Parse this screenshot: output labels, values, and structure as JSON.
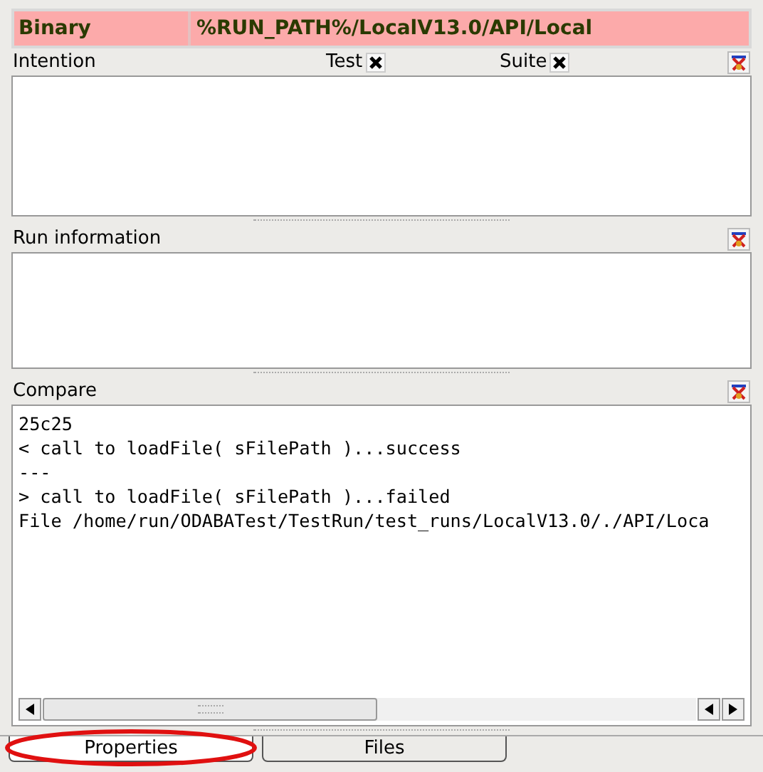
{
  "header": {
    "label": "Binary",
    "value": "%RUN_PATH%/LocalV13.0/API/Local"
  },
  "panels": [
    {
      "kind": "intention",
      "title": "Intention",
      "checks": [
        {
          "label": "Test",
          "checked": true
        },
        {
          "label": "Suite",
          "checked": true
        }
      ]
    },
    {
      "kind": "plain",
      "title": "Run information"
    },
    {
      "kind": "compare",
      "title": "Compare",
      "lines": [
        "25c25",
        "< call to loadFile( sFilePath )...success",
        "---",
        "> call to loadFile( sFilePath )...failed",
        "File /home/run/ODABATest/TestRun/test_runs/LocalV13.0/./API/Loca"
      ]
    }
  ],
  "tabs": [
    {
      "label": "Properties",
      "selected": true,
      "highlighted": true
    },
    {
      "label": "Files",
      "selected": false,
      "highlighted": false
    }
  ]
}
